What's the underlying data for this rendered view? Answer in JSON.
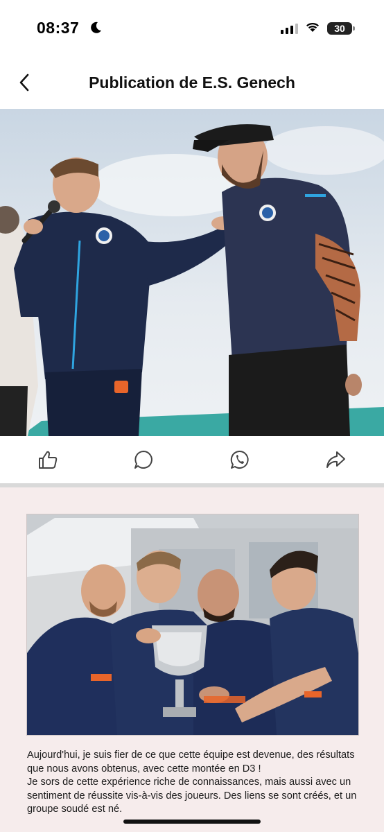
{
  "status": {
    "time": "08:37",
    "battery": "30",
    "icons": [
      "moon-icon",
      "cellular-signal-icon",
      "wifi-icon",
      "battery-icon"
    ]
  },
  "nav": {
    "title": "Publication de E.S. Genech",
    "back_icon": "chevron-left-icon"
  },
  "hero_image": {
    "description": "photo",
    "icon": "photo"
  },
  "actions": [
    {
      "name": "like",
      "icon": "thumbs-up-icon"
    },
    {
      "name": "comment",
      "icon": "comment-bubble-icon"
    },
    {
      "name": "whatsapp",
      "icon": "whatsapp-icon"
    },
    {
      "name": "share",
      "icon": "share-arrow-icon"
    }
  ],
  "post": {
    "paragraphs": [
      "Aujourd'hui, je suis fier de ce que cette équipe est devenue, des résultats que nous avons obtenus, avec cette montée en D3 !",
      "Je sors de cette expérience riche de connaissances, mais aussi avec un sentiment de réussite vis-à-vis des joueurs. Des liens se sont créés, et un groupe soudé est né."
    ]
  },
  "colors": {
    "card_background": "#f6ecec",
    "jersey_navy": "#1e2a4a",
    "accent_orange": "#e8652a"
  }
}
